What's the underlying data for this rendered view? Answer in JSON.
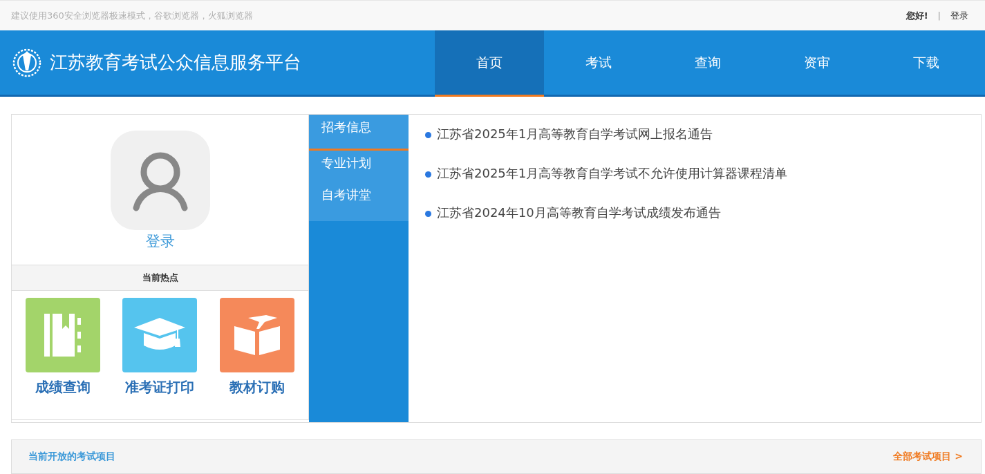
{
  "top_bar": {
    "notice": "建议使用360安全浏览器极速模式，谷歌浏览器，火狐浏览器",
    "greeting": "您好!",
    "separator": "|",
    "login": "登录"
  },
  "header": {
    "site_title": "江苏教育考试公众信息服务平台",
    "nav": [
      {
        "label": "首页",
        "selected": true
      },
      {
        "label": "考试",
        "selected": false
      },
      {
        "label": "查询",
        "selected": false
      },
      {
        "label": "资审",
        "selected": false
      },
      {
        "label": "下载",
        "selected": false
      }
    ]
  },
  "user_panel": {
    "login_link": "登录",
    "hot_title": "当前热点",
    "hot_items": [
      {
        "label": "成绩查询",
        "kind": "notebook",
        "color": "#a3d46a"
      },
      {
        "label": "准考证打印",
        "kind": "cap",
        "color": "#55c4ee"
      },
      {
        "label": "教材订购",
        "kind": "book",
        "color": "#f5895a"
      }
    ]
  },
  "news_tabs": [
    {
      "label": "招考信息",
      "selected": true
    },
    {
      "label": "专业计划",
      "selected": false
    },
    {
      "label": "自考讲堂",
      "selected": false
    }
  ],
  "news": [
    "江苏省2025年1月高等教育自学考试网上报名通告",
    "江苏省2025年1月高等教育自学考试不允许使用计算器课程清单",
    "江苏省2024年10月高等教育自学考试成绩发布通告"
  ],
  "exam_bar": {
    "title": "当前开放的考试项目",
    "more_link": "全部考试项目 >"
  }
}
